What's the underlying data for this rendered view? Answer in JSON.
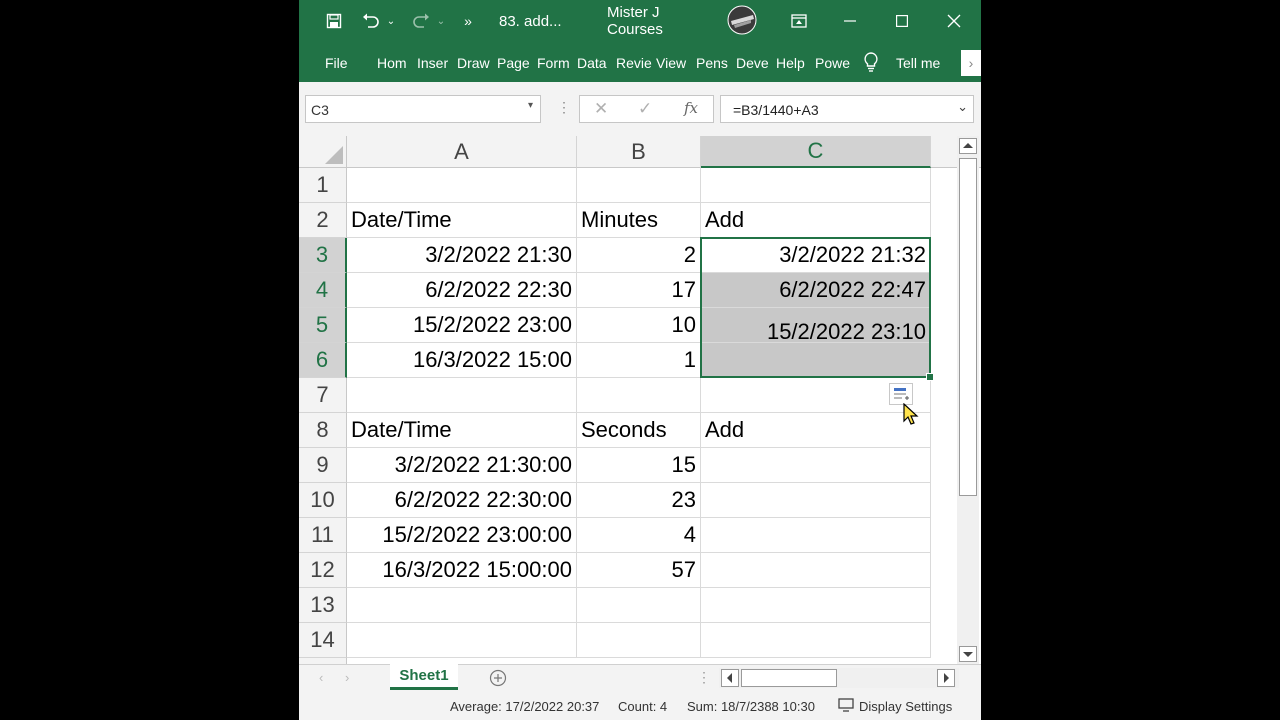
{
  "window": {
    "title": "83. add...",
    "user": "Mister J Courses"
  },
  "ribbon": {
    "tabs": [
      "File",
      "Hom",
      "Inser",
      "Draw",
      "Page",
      "Form",
      "Data",
      "Revie",
      "View",
      "Pens",
      "Deve",
      "Help",
      "Powe"
    ],
    "tell_me": "Tell me"
  },
  "formula_bar": {
    "name_box": "C3",
    "formula": "=B3/1440+A3"
  },
  "grid": {
    "columns": [
      "A",
      "B",
      "C"
    ],
    "rows": [
      "1",
      "2",
      "3",
      "4",
      "5",
      "6",
      "7",
      "8",
      "9",
      "10",
      "11",
      "12",
      "13",
      "14"
    ],
    "cells": {
      "A2": "Date/Time",
      "B2": "Minutes",
      "C2": "Add",
      "A3": "3/2/2022 21:30",
      "B3": "2",
      "C3": "3/2/2022 21:32",
      "A4": "6/2/2022 22:30",
      "B4": "17",
      "C4": "6/2/2022 22:47",
      "A5": "15/2/2022 23:00",
      "B5": "10",
      "C5": "15/2/2022 23:10",
      "A6": "16/3/2022 15:00",
      "B6": "1",
      "A8": "Date/Time",
      "B8": "Seconds",
      "C8": "Add",
      "A9": "3/2/2022 21:30:00",
      "B9": "15",
      "A10": "6/2/2022 22:30:00",
      "B10": "23",
      "A11": "15/2/2022 23:00:00",
      "B11": "4",
      "A12": "16/3/2022 15:00:00",
      "B12": "57"
    }
  },
  "sheets": [
    "Sheet1"
  ],
  "status": {
    "average": "Average: 17/2/2022 20:37",
    "count": "Count: 4",
    "sum": "Sum: 18/7/2388 10:30",
    "display_settings": "Display Settings"
  },
  "colors": {
    "accent": "#217346",
    "selection_fill": "#c8c8c8"
  }
}
